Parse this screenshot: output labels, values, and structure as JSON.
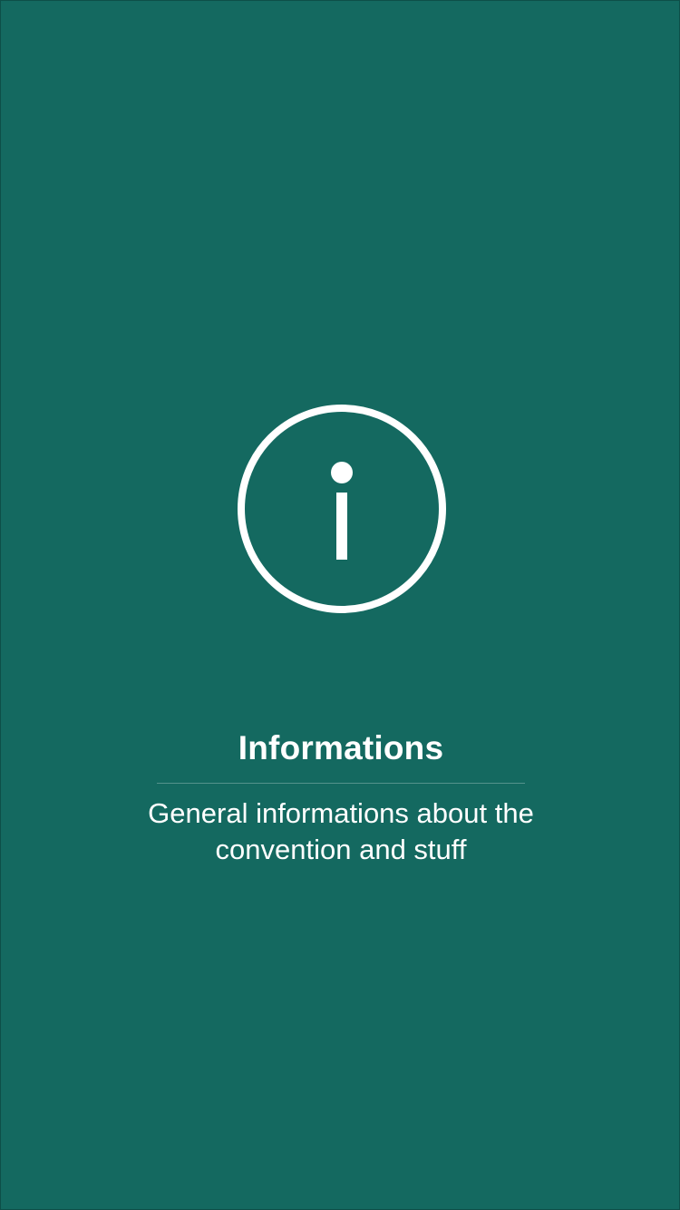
{
  "page": {
    "background_color": "#146960",
    "icon": {
      "name": "info-circle-icon",
      "color": "#ffffff"
    },
    "title": "Informations",
    "description": "General informations about the convention and stuff"
  }
}
